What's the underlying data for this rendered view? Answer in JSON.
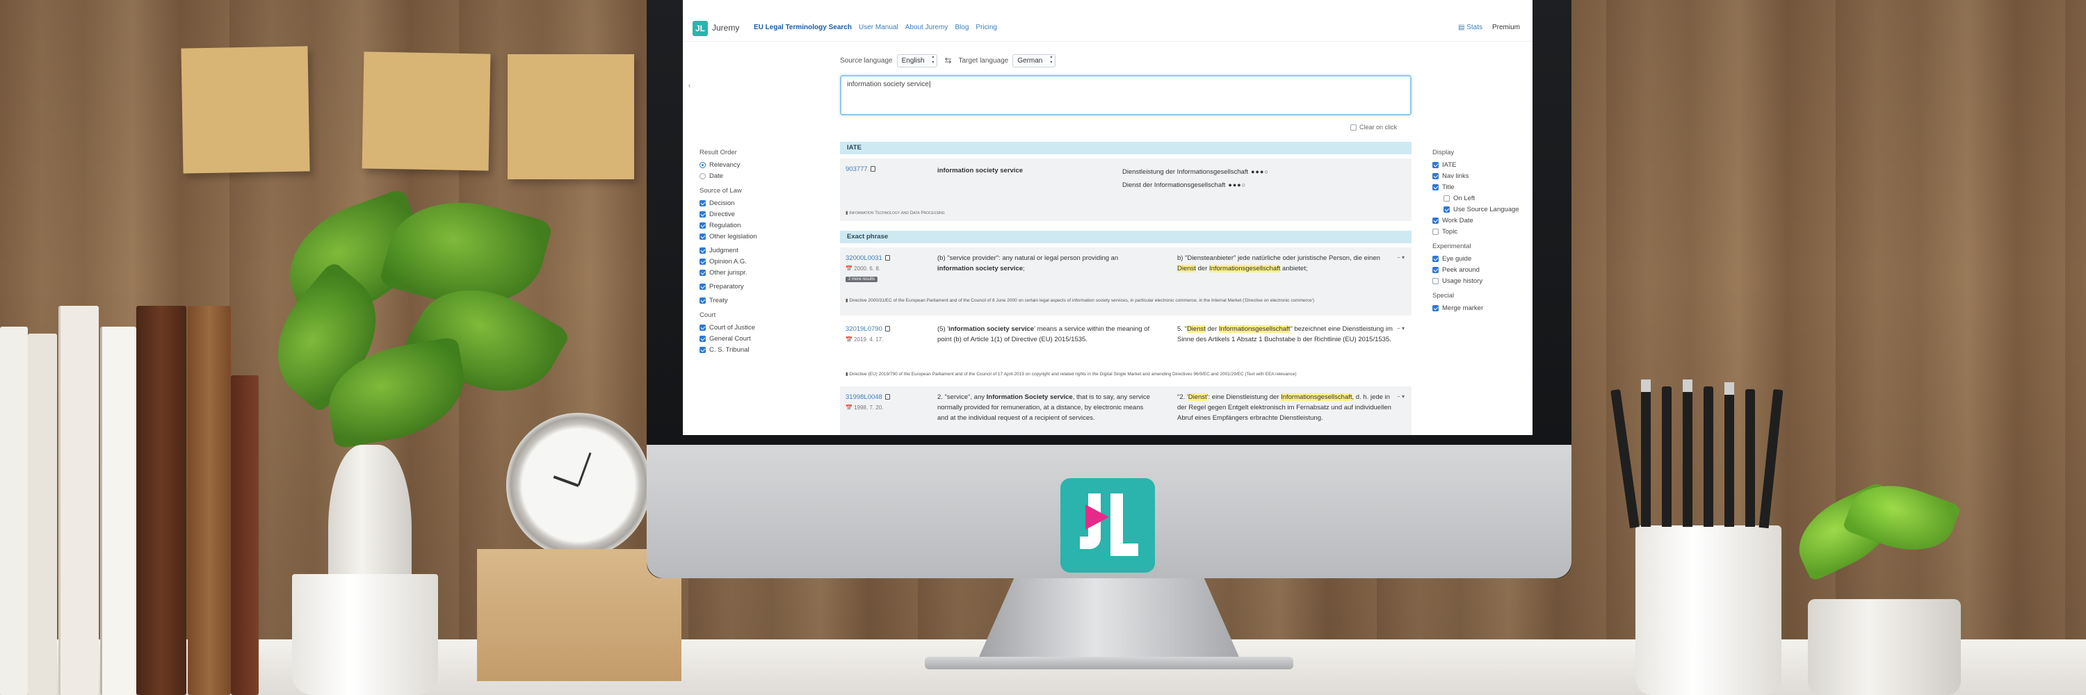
{
  "app": {
    "brand_mark": "JL",
    "brand": "Juremy"
  },
  "nav": {
    "items": [
      "EU Legal Terminology Search",
      "User Manual",
      "About Juremy",
      "Blog",
      "Pricing"
    ],
    "stats": "Stats",
    "premium": "Premium"
  },
  "search": {
    "source_label": "Source language",
    "source_value": "English",
    "target_label": "Target language",
    "target_value": "German",
    "query": "information society service",
    "clear_on_click": "Clear on click"
  },
  "left_panel": {
    "result_order_heading": "Result Order",
    "result_order": [
      {
        "label": "Relevancy",
        "checked": true
      },
      {
        "label": "Date",
        "checked": false
      }
    ],
    "source_heading": "Source of Law",
    "legislation": [
      "Decision",
      "Directive",
      "Regulation",
      "Other legislation"
    ],
    "jurisprudence": [
      "Judgment",
      "Opinion A.G.",
      "Other jurispr."
    ],
    "preparatory": "Preparatory",
    "treaty": "Treaty",
    "court_heading": "Court",
    "courts": [
      "Court of Justice",
      "General Court",
      "C. S. Tribunal"
    ]
  },
  "right_panel": {
    "display_heading": "Display",
    "display": [
      {
        "label": "IATE",
        "checked": true,
        "indent": false
      },
      {
        "label": "Nav links",
        "checked": true,
        "indent": false
      },
      {
        "label": "Title",
        "checked": true,
        "indent": false
      },
      {
        "label": "On Left",
        "checked": false,
        "indent": true
      },
      {
        "label": "Use Source Language",
        "checked": true,
        "indent": true
      },
      {
        "label": "Work Date",
        "checked": true,
        "indent": false
      },
      {
        "label": "Topic",
        "checked": false,
        "indent": false
      }
    ],
    "experimental_heading": "Experimental",
    "experimental": [
      {
        "label": "Eye guide",
        "checked": true
      },
      {
        "label": "Peek around",
        "checked": true
      },
      {
        "label": "Usage history",
        "checked": false
      }
    ],
    "special_heading": "Special",
    "special": [
      {
        "label": "Merge marker",
        "checked": true
      }
    ]
  },
  "iate": {
    "heading": "IATE",
    "id": "903777",
    "term": "information society service",
    "translations": [
      {
        "text": "Dienstleistung der Informationsgesellschaft",
        "rating": "●●●○"
      },
      {
        "text": "Dienst der Informationsgesellschaft",
        "rating": "●●●○"
      }
    ],
    "domain": "Information Technology And Data Processing"
  },
  "exact": {
    "heading": "Exact phrase",
    "results": [
      {
        "celex": "32000L0031",
        "date": "2000. 6. 8.",
        "tag": "2 more results",
        "src_pre": "(b) \"service provider\": any natural or legal person providing an ",
        "src_bold": "information society service",
        "src_post": ";",
        "tgt_pre": "b) \"Diensteanbieter\" jede natürliche oder juristische Person, die einen ",
        "tgt_h1": "Dienst",
        "tgt_mid": " der ",
        "tgt_h2": "Informationsgesellschaft",
        "tgt_post": " anbietet;",
        "note": "Directive 2000/31/EC of the European Parliament and of the Council of 8 June 2000 on certain legal aspects of information society services, in particular electronic commerce, in the Internal Market ('Directive on electronic commerce')"
      },
      {
        "celex": "32019L0790",
        "date": "2019. 4. 17.",
        "src_pre": "(5) '",
        "src_bold": "information society service",
        "src_post": "' means a service within the meaning of point (b) of Article 1(1) of Directive (EU) 2015/1535.",
        "tgt_pre": "5. \"",
        "tgt_h1": "Dienst",
        "tgt_mid": " der ",
        "tgt_h2": "Informationsgesellschaft",
        "tgt_post": "\" bezeichnet eine Dienstleistung im Sinne des Artikels 1 Absatz 1 Buchstabe b der Richtlinie (EU) 2015/1535.",
        "note": "Directive (EU) 2019/790 of the European Parliament and of the Council of 17 April 2019 on copyright and related rights in the Digital Single Market and amending Directives 96/9/EC and 2001/29/EC (Text with EEA relevance)"
      },
      {
        "celex": "31998L0048",
        "date": "1998. 7. 20.",
        "src_pre": "2. \"service\", any ",
        "src_bold": "Information Society service",
        "src_post": ", that is to say, any service normally provided for remuneration, at a distance, by electronic means and at the individual request of a recipient of services.",
        "tgt_pre": "\"2. '",
        "tgt_h1": "Dienst",
        "tgt_mid": "': eine Dienstleistung der ",
        "tgt_h2": "Informationsgesellschaft",
        "tgt_post": ", d. h. jede in der Regel gegen Entgelt elektronisch im Fernabsatz und auf individuellen Abruf eines Empfängers erbrachte Dienstleistung."
      }
    ]
  }
}
